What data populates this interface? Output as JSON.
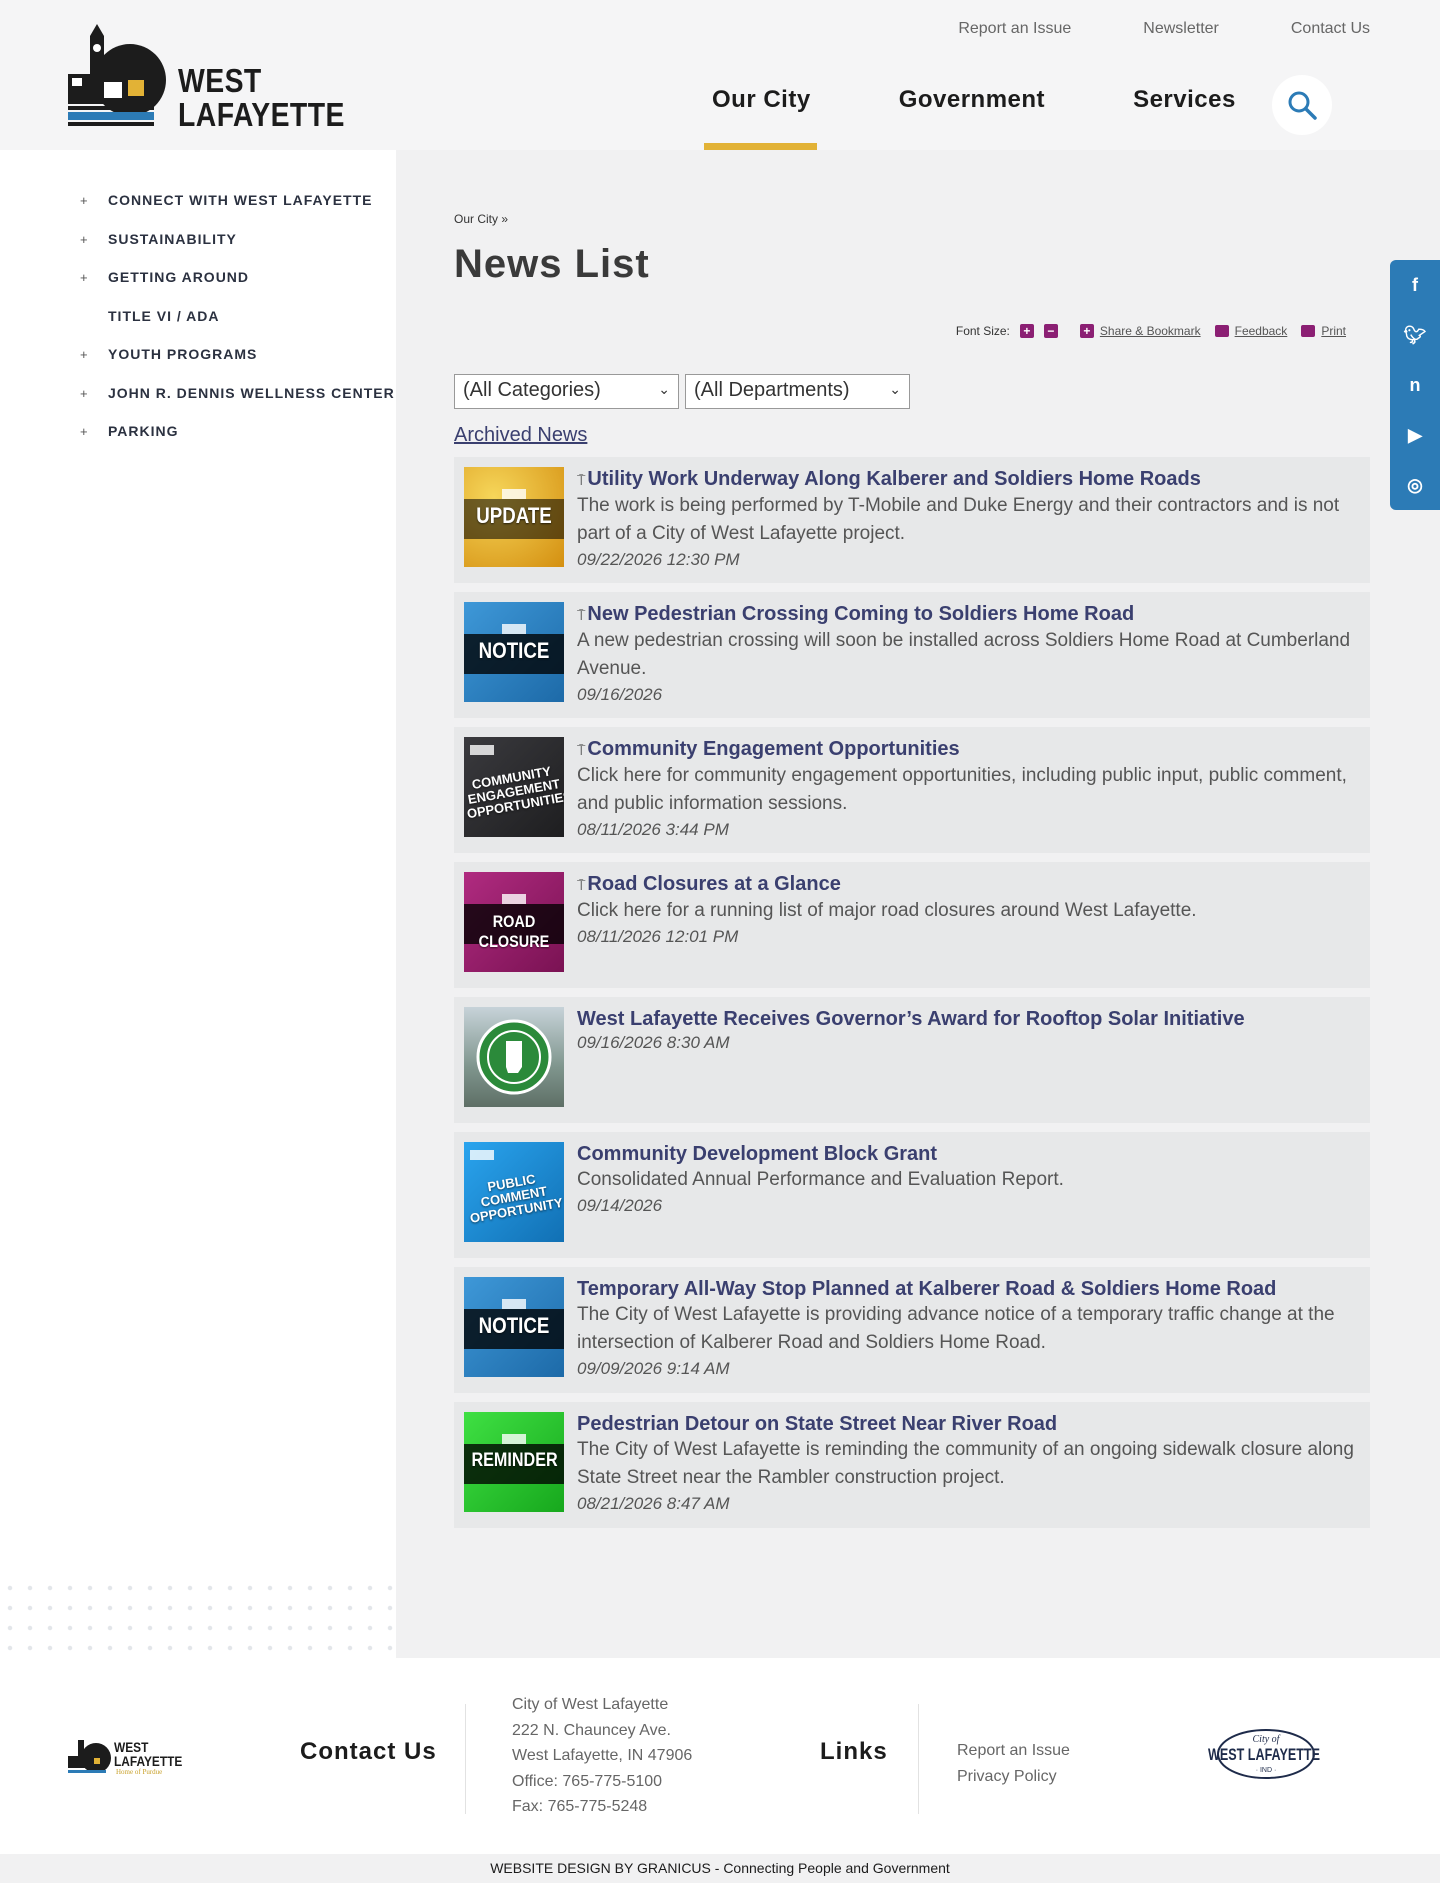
{
  "header": {
    "logo_text_line1": "WEST",
    "logo_text_line2": "LAFAYETTE",
    "utility_nav": [
      "Report an Issue",
      "Newsletter",
      "Contact Us"
    ],
    "main_nav": [
      "Our City",
      "Government",
      "Services"
    ],
    "active_nav": "Our City",
    "accent_color": "#e2b236"
  },
  "sidebar": {
    "items": [
      {
        "label": "CONNECT WITH WEST LAFAYETTE",
        "expandable": true
      },
      {
        "label": "SUSTAINABILITY",
        "expandable": true
      },
      {
        "label": "GETTING AROUND",
        "expandable": true
      },
      {
        "label": "TITLE VI / ADA",
        "expandable": false
      },
      {
        "label": "YOUTH PROGRAMS",
        "expandable": true
      },
      {
        "label": "JOHN R. DENNIS WELLNESS CENTER",
        "expandable": true
      },
      {
        "label": "PARKING",
        "expandable": true
      }
    ]
  },
  "main": {
    "breadcrumb": "Our City »",
    "title": "News List",
    "tools": {
      "font_size_label": "Font Size:",
      "share_label": "Share & Bookmark",
      "feedback_label": "Feedback",
      "print_label": "Print"
    },
    "filters": {
      "categories": "(All Categories)",
      "departments": "(All Departments)"
    },
    "archived_link": "Archived News",
    "news": [
      {
        "title": "Utility Work Underway Along Kalberer and Soldiers Home Roads",
        "pinned": true,
        "description": "The work is being performed by T-Mobile and Duke Energy and their contractors and is not part of a City of West Lafayette project.",
        "date": "09/22/2026 12:30 PM",
        "thumb_label": "UPDATE",
        "thumb_color": "#e9a91b"
      },
      {
        "title": "New Pedestrian Crossing Coming to Soldiers Home Road",
        "pinned": true,
        "description": "A new pedestrian crossing will soon be installed across Soldiers Home Road at Cumberland Avenue.",
        "date": "09/16/2026",
        "thumb_label": "NOTICE",
        "thumb_color": "#2a7fc0"
      },
      {
        "title": "Community Engagement Opportunities",
        "pinned": true,
        "description": "Click here for community engagement opportunities, including public input, public comment, and public information sessions.",
        "date": "08/11/2026 3:44 PM",
        "thumb_label": "COMMUNITY ENGAGEMENT OPPORTUNITIES",
        "thumb_color": "#2b2b2e"
      },
      {
        "title": "Road Closures at a Glance",
        "pinned": true,
        "description": "Click here for a running list of major road closures around West Lafayette.",
        "date": "08/11/2026 12:01 PM",
        "thumb_label": "ROAD CLOSURE",
        "thumb_color": "#9b1a6c"
      },
      {
        "title": "West Lafayette Receives Governor’s Award for Rooftop Solar Initiative",
        "pinned": false,
        "description": "",
        "date": "09/16/2026 8:30 AM",
        "thumb_label": "",
        "thumb_color": "#6c8e86"
      },
      {
        "title": "Community Development Block Grant",
        "pinned": false,
        "description": "Consolidated Annual Performance and Evaluation Report.",
        "date": "09/14/2026",
        "thumb_label": "PUBLIC COMMENT OPPORTUNITY",
        "thumb_color": "#1a8fd6"
      },
      {
        "title": "Temporary All-Way Stop Planned at Kalberer Road & Soldiers Home Road",
        "pinned": false,
        "description": "The City of West Lafayette is providing advance notice of a temporary traffic change at the intersection of Kalberer Road and Soldiers Home Road.",
        "date": "09/09/2026 9:14 AM",
        "thumb_label": "NOTICE",
        "thumb_color": "#2a7fc0"
      },
      {
        "title": "Pedestrian Detour on State Street Near River Road",
        "pinned": false,
        "description": "The City of West Lafayette is reminding the community of an ongoing sidewalk closure along State Street near the Rambler construction project.",
        "date": "08/21/2026 8:47 AM",
        "thumb_label": "REMINDER",
        "thumb_color": "#22c42a"
      }
    ]
  },
  "social": [
    "facebook-icon",
    "twitter-icon",
    "nextdoor-icon",
    "youtube-icon",
    "instagram-icon"
  ],
  "footer": {
    "logo_line1": "WEST",
    "logo_line2": "LAFAYETTE",
    "logo_sub": "Home of Purdue",
    "contact_heading": "Contact Us",
    "contact_lines": [
      "City of West Lafayette",
      "222 N. Chauncey Ave.",
      "West Lafayette, IN 47906",
      "Office: 765-775-5100",
      "Fax: 765-775-5248"
    ],
    "links_heading": "Links",
    "links": [
      "Report an Issue",
      "Privacy Policy"
    ],
    "seal_top": "City of",
    "seal_main": "WEST LAFAYETTE",
    "seal_bottom": "· IND ·",
    "credit": "WEBSITE DESIGN BY GRANICUS - Connecting People and Government"
  }
}
